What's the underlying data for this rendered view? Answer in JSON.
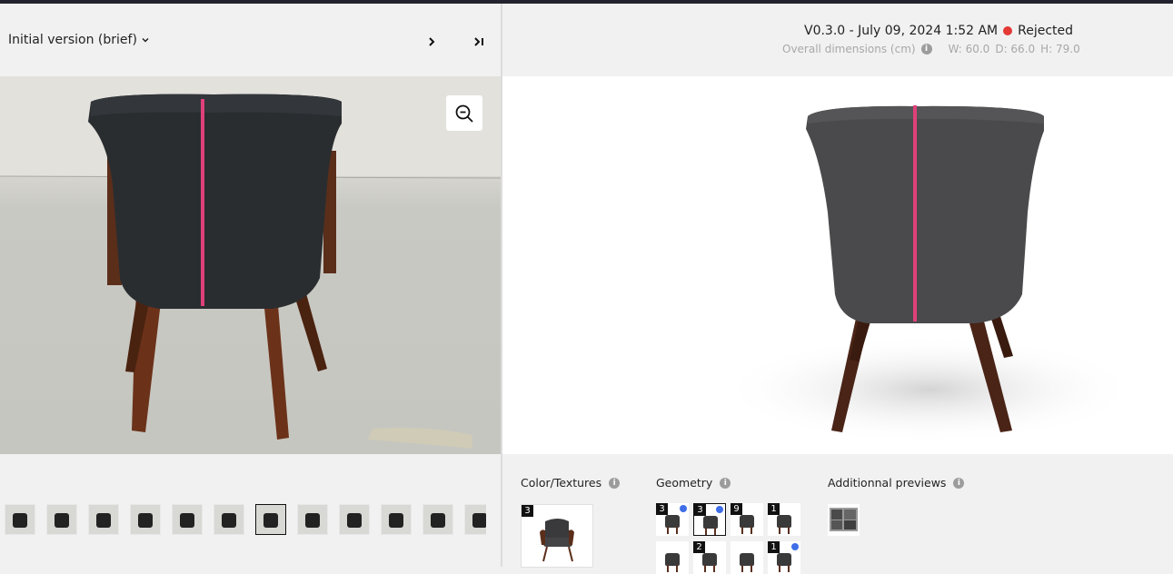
{
  "left": {
    "version_select": {
      "label": "Initial version (brief)"
    },
    "nav": {
      "next": "next",
      "last": "last"
    },
    "thumbnails_count": 12,
    "active_thumbnail": 6
  },
  "right": {
    "version": {
      "text": "V0.3.0 - July 09, 2024 1:52 AM",
      "status": "Rejected",
      "status_color": "#e53935"
    },
    "dimensions": {
      "label": "Overall dimensions (cm)",
      "w": "W: 60.0",
      "d": "D: 66.0",
      "h": "H: 79.0"
    },
    "sections": {
      "color_textures": {
        "title": "Color/Textures",
        "count": "3"
      },
      "geometry": {
        "title": "Geometry",
        "items": [
          {
            "count": "3",
            "dot": true
          },
          {
            "count": "3",
            "dot": true,
            "active": true
          },
          {
            "count": "9",
            "dot": false
          },
          {
            "count": "1",
            "dot": false
          },
          {
            "count": "",
            "dot": false
          },
          {
            "count": "2",
            "dot": false
          },
          {
            "count": "",
            "dot": false
          },
          {
            "count": "1",
            "dot": true
          }
        ]
      },
      "previews": {
        "title": "Additionnal previews"
      }
    }
  },
  "colors": {
    "accent_line": "#e0407a",
    "dot_blue": "#3f6ee8"
  }
}
